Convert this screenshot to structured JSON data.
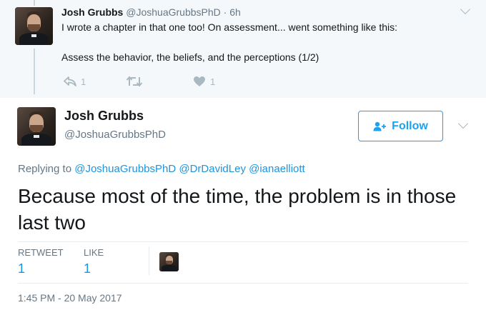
{
  "parent_tweet": {
    "name": "Josh Grubbs",
    "handle": "@JoshuaGrubbsPhD",
    "time": "· 6h",
    "text_line1": "I wrote a chapter in that one too! On assessment... went something like this:",
    "text_line2": "Assess the behavior, the beliefs, and the perceptions (1/2)",
    "reply_count": "1",
    "retweet_count": "",
    "like_count": "1",
    "icons": [
      "reply-icon",
      "retweet-icon",
      "heart-icon",
      "chevron-down-icon"
    ]
  },
  "main_tweet": {
    "name": "Josh Grubbs",
    "handle": "@JoshuaGrubbsPhD",
    "follow_label": "Follow",
    "replying_prefix": "Replying to",
    "mentions": [
      "@JoshuaGrubbsPhD",
      "@DrDavidLey",
      "@ianaelliott"
    ],
    "text": "Because most of the time, the problem is in those last two",
    "retweet_label": "RETWEET",
    "retweet_count": "1",
    "like_label": "LIKE",
    "like_count": "1",
    "timestamp": "1:45 PM - 20 May 2017",
    "icons": [
      "follow-user-icon",
      "chevron-down-icon"
    ]
  },
  "colors": {
    "accent": "#1da1f2",
    "link": "#1b95e0",
    "muted": "#657786",
    "parent_background": "#f5f8fa"
  }
}
